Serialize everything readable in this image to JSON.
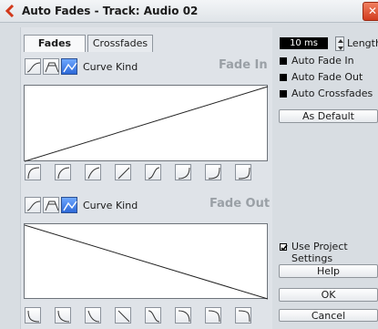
{
  "window": {
    "title": "Auto Fades - Track: Audio 02"
  },
  "tabs": {
    "fades": "Fades",
    "crossfades": "Crossfades"
  },
  "fade_in": {
    "curve_kind_label": "Curve Kind",
    "title": "Fade In"
  },
  "fade_out": {
    "curve_kind_label": "Curve Kind",
    "title": "Fade Out"
  },
  "length": {
    "value": "10 ms",
    "label": "Length"
  },
  "options": {
    "auto_fade_in": "Auto Fade In",
    "auto_fade_out": "Auto Fade Out",
    "auto_crossfades": "Auto Crossfades",
    "use_project_settings": "Use Project Settings"
  },
  "buttons": {
    "as_default": "As Default",
    "help": "Help",
    "ok": "OK",
    "cancel": "Cancel"
  },
  "colors": {
    "selected_curve": "#2d69d8",
    "accent_close": "#d23c1e"
  }
}
